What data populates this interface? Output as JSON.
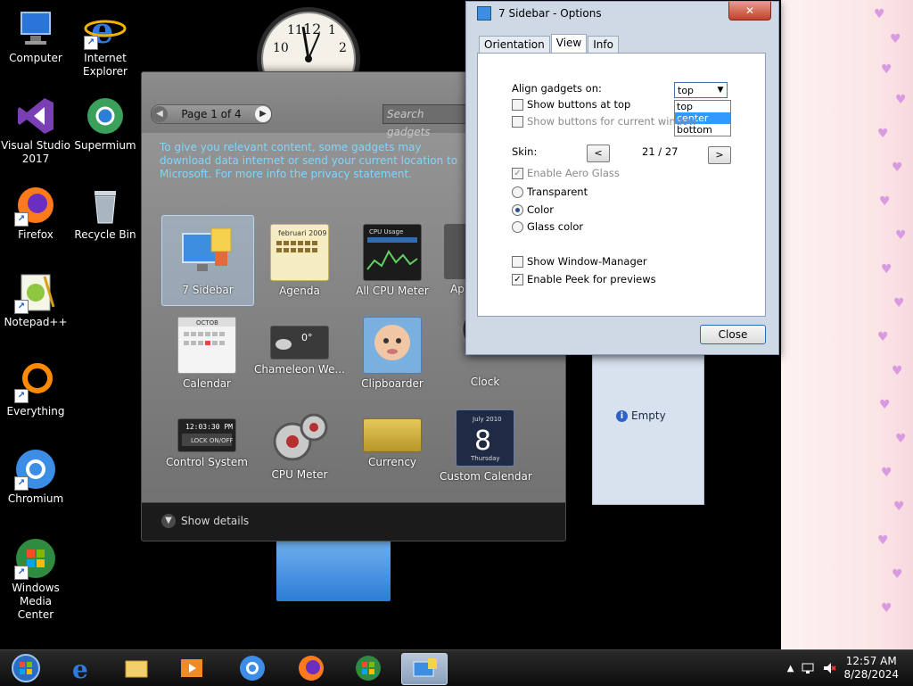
{
  "desktop": {
    "icons": [
      {
        "label": "Computer",
        "icon": "computer-icon"
      },
      {
        "label": "Internet Explorer",
        "icon": "internet-explorer-icon"
      },
      {
        "label": "Visual Studio 2017",
        "icon": "visual-studio-icon"
      },
      {
        "label": "Supermium",
        "icon": "supermium-icon"
      },
      {
        "label": "Firefox",
        "icon": "firefox-icon"
      },
      {
        "label": "Recycle Bin",
        "icon": "recycle-bin-icon"
      },
      {
        "label": "Notepad++",
        "icon": "notepad-plus-plus-icon"
      },
      {
        "label": "Everything",
        "icon": "everything-icon"
      },
      {
        "label": "Chromium",
        "icon": "chromium-icon"
      },
      {
        "label": "Windows Media Center",
        "icon": "windows-media-center-icon"
      }
    ]
  },
  "sidebar_panel": {
    "empty_label": "Empty"
  },
  "gallery": {
    "page_label": "Page 1 of 4",
    "search_placeholder": "Search gadgets",
    "notice": "To give you relevant content, some gadgets may download data internet or send your current location to Microsoft. For more info the privacy statement.",
    "gadgets": [
      {
        "name": "7 Sidebar",
        "selected": true
      },
      {
        "name": "Agenda"
      },
      {
        "name": "All CPU Meter"
      },
      {
        "name": "Ap"
      },
      {
        "name": "Calendar"
      },
      {
        "name": "Chameleon We..."
      },
      {
        "name": "Clipboarder"
      },
      {
        "name": "Clock"
      },
      {
        "name": "Control System"
      },
      {
        "name": "CPU Meter"
      },
      {
        "name": "Currency"
      },
      {
        "name": "Custom Calendar"
      }
    ],
    "show_details": "Show details"
  },
  "dialog": {
    "title": "7 Sidebar - Options",
    "close_x": "✕",
    "tabs": [
      "Orientation",
      "View",
      "Info"
    ],
    "active_tab": "View",
    "align_label": "Align gadgets on:",
    "align_value": "top",
    "align_options": [
      "top",
      "center",
      "bottom"
    ],
    "align_highlighted": "center",
    "show_buttons_top": "Show buttons at top",
    "show_buttons_window": "Show buttons for current window",
    "skin_label": "Skin:",
    "skin_prev": "<",
    "skin_next": ">",
    "skin_value": "21 / 27",
    "enable_aero": "Enable Aero Glass",
    "transparent": "Transparent",
    "color": "Color",
    "glass_color": "Glass color",
    "show_window_manager": "Show Window-Manager",
    "enable_peek": "Enable Peek for previews",
    "close_button": "Close"
  },
  "taskbar": {
    "time": "12:57 AM",
    "date": "8/28/2024",
    "apps": [
      "start-orb-icon",
      "internet-explorer-icon",
      "file-explorer-icon",
      "media-player-icon",
      "chromium-icon",
      "firefox-icon",
      "media-center-icon",
      "7-sidebar-icon"
    ]
  }
}
